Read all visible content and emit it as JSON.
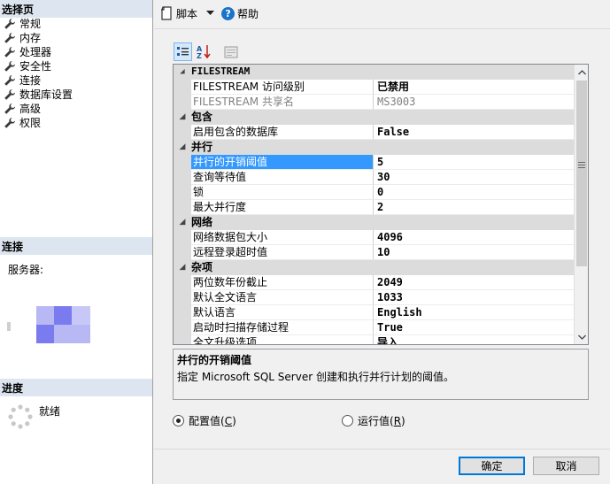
{
  "left_pane": {
    "select_page_header": "选择页",
    "nav_items": [
      {
        "label": "常规",
        "icon": "wrench-icon"
      },
      {
        "label": "内存",
        "icon": "wrench-icon"
      },
      {
        "label": "处理器",
        "icon": "wrench-icon"
      },
      {
        "label": "安全性",
        "icon": "wrench-icon"
      },
      {
        "label": "连接",
        "icon": "wrench-icon"
      },
      {
        "label": "数据库设置",
        "icon": "wrench-icon"
      },
      {
        "label": "高级",
        "icon": "wrench-icon"
      },
      {
        "label": "权限",
        "icon": "wrench-icon"
      }
    ],
    "connection_header": "连接",
    "server_label": "服务器:",
    "progress_header": "进度",
    "progress_status": "就绪"
  },
  "toolbar": {
    "script_label": "脚本",
    "help_label": "帮助"
  },
  "grid": {
    "categories": [
      {
        "name": "FILESTREAM",
        "properties": [
          {
            "name": "FILESTREAM 访问级别",
            "value": "已禁用"
          },
          {
            "name": "FILESTREAM 共享名",
            "value": "MS3003",
            "disabled": true
          }
        ]
      },
      {
        "name": "包含",
        "properties": [
          {
            "name": "启用包含的数据库",
            "value": "False"
          }
        ]
      },
      {
        "name": "并行",
        "properties": [
          {
            "name": "并行的开销阈值",
            "value": "5",
            "selected": true
          },
          {
            "name": "查询等待值",
            "value": "30"
          },
          {
            "name": "锁",
            "value": "0"
          },
          {
            "name": "最大并行度",
            "value": "2"
          }
        ]
      },
      {
        "name": "网络",
        "properties": [
          {
            "name": "网络数据包大小",
            "value": "4096"
          },
          {
            "name": "远程登录超时值",
            "value": "10"
          }
        ]
      },
      {
        "name": "杂项",
        "properties": [
          {
            "name": "两位数年份截止",
            "value": "2049"
          },
          {
            "name": "默认全文语言",
            "value": "1033"
          },
          {
            "name": "默认语言",
            "value": "English"
          },
          {
            "name": "启动时扫描存储过程",
            "value": "True"
          },
          {
            "name": "全文升级选项",
            "value": "导入"
          }
        ]
      }
    ]
  },
  "description": {
    "title": "并行的开销阈值",
    "text": "指定 Microsoft SQL Server 创建和执行并行计划的阈值。"
  },
  "radios": {
    "configured": {
      "label": "配置值",
      "key": "C",
      "checked": true
    },
    "running": {
      "label": "运行值",
      "key": "R",
      "checked": false
    }
  },
  "buttons": {
    "ok": "确定",
    "cancel": "取消"
  },
  "colors": {
    "selection": "#3399ff",
    "header_bg": "#dde6f0",
    "category_bg": "#dcdcdc"
  }
}
